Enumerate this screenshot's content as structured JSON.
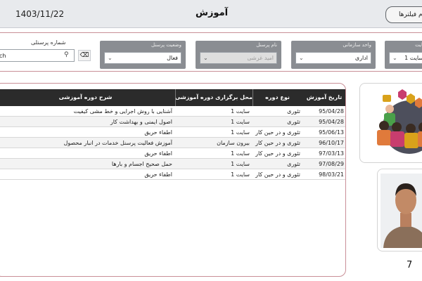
{
  "header": {
    "date": "1403/11/22",
    "title": "آموزش",
    "filters_button": "تمام فیلترها"
  },
  "filters": {
    "site": {
      "label": "سایت",
      "value": "سایت 1"
    },
    "org_unit": {
      "label": "واحد سازمانی",
      "value": "اداری"
    },
    "personnel_title": {
      "label": "نام پرسنل",
      "value": "امید غرشی"
    },
    "personnel_status": {
      "label": "وضعیت پرسنل",
      "value": "فعال"
    },
    "personnel_number": {
      "label": "شماره پرسنلی",
      "search_value": "ch"
    }
  },
  "table": {
    "columns": {
      "date": "تاریخ آموزش",
      "type": "نوع دوره",
      "location": "محل برگزاری دوره آموزشی",
      "description": "شرح دوره آموزشی"
    },
    "rows": [
      {
        "date": "95/04/28",
        "type": "تئوری",
        "location": "سایت 1",
        "description": "آشنایی با روش اجرایی و خط مشی کیفیت"
      },
      {
        "date": "95/04/28",
        "type": "تئوری",
        "location": "سایت 1",
        "description": "اصول ایمنی و بهداشت کار"
      },
      {
        "date": "95/06/13",
        "type": "تئوری و در حین کار",
        "location": "سایت 1",
        "description": "اطفاء حریق"
      },
      {
        "date": "96/10/17",
        "type": "تئوری و در حین کار",
        "location": "بیرون سازمان",
        "description": "آموزش فعالیت پرسنل خدمات در انبار محصول"
      },
      {
        "date": "97/03/13",
        "type": "تئوری و در حین کار",
        "location": "سایت 1",
        "description": "اطفاء حریق"
      },
      {
        "date": "97/08/29",
        "type": "تئوری",
        "location": "سایت 1",
        "description": "حمل صحیح اجسام و بارها"
      },
      {
        "date": "98/03/21",
        "type": "تئوری و در حین کار",
        "location": "سایت 1",
        "description": "اطفاء حریق"
      }
    ]
  },
  "stats": {
    "count": "7"
  },
  "icons": {
    "search": "search-icon",
    "eraser": "eraser-icon",
    "chevron": "chevron-down-icon"
  },
  "colors": {
    "header_bg": "#e8eaed",
    "filter_box": "#8a8d92",
    "table_header": "#2b2b2b",
    "panel_border": "#c98f97"
  }
}
